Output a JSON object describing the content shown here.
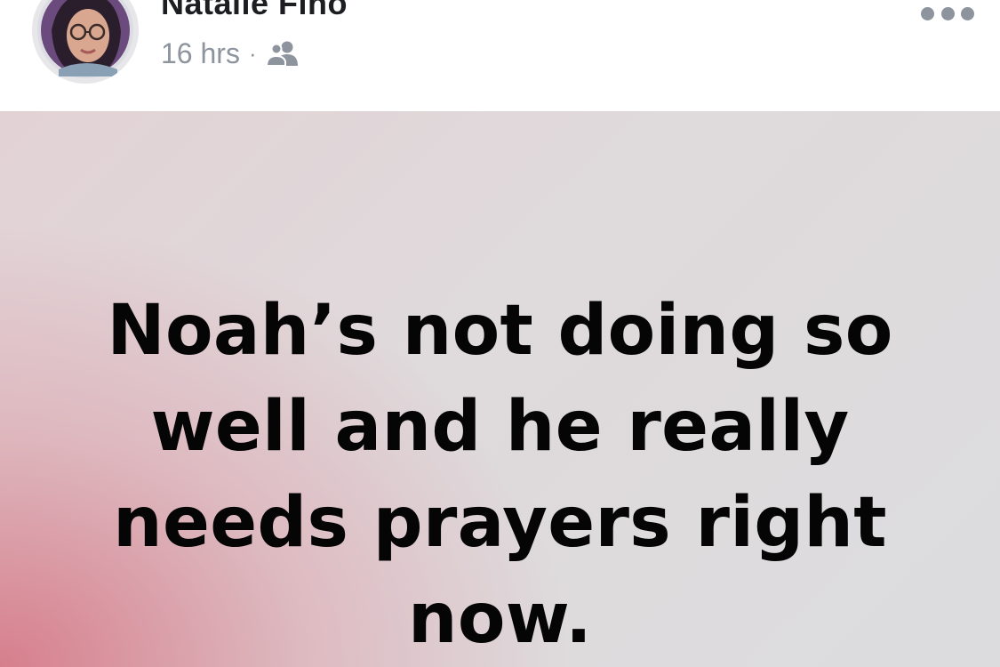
{
  "post": {
    "author_name": "Natalie Fino",
    "timestamp": "16 hrs",
    "separator": "·",
    "audience_icon": "friends-icon",
    "more_icon": "more-options-icon",
    "status_text": "Noah’s not doing so well and he really needs prayers right now.",
    "colors": {
      "name": "#1c1e21",
      "meta": "#8d949e",
      "status_text": "#050505",
      "background_pink": "#d67a88",
      "background_gray": "#dcdcde"
    }
  }
}
